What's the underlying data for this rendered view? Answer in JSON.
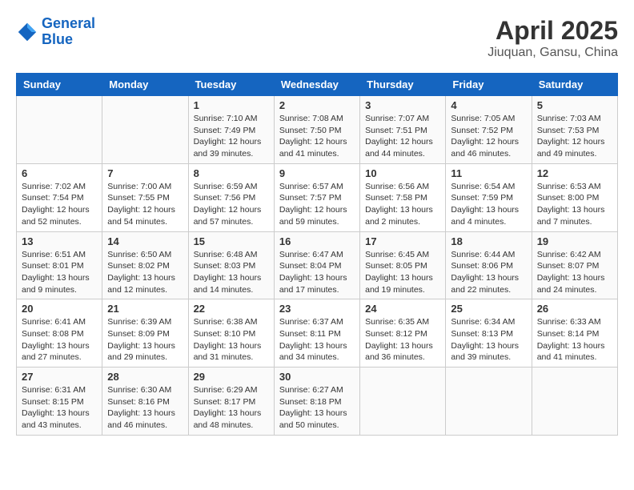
{
  "logo": {
    "line1": "General",
    "line2": "Blue"
  },
  "title": "April 2025",
  "subtitle": "Jiuquan, Gansu, China",
  "weekdays": [
    "Sunday",
    "Monday",
    "Tuesday",
    "Wednesday",
    "Thursday",
    "Friday",
    "Saturday"
  ],
  "weeks": [
    [
      {
        "day": "",
        "info": ""
      },
      {
        "day": "",
        "info": ""
      },
      {
        "day": "1",
        "info": "Sunrise: 7:10 AM\nSunset: 7:49 PM\nDaylight: 12 hours\nand 39 minutes."
      },
      {
        "day": "2",
        "info": "Sunrise: 7:08 AM\nSunset: 7:50 PM\nDaylight: 12 hours\nand 41 minutes."
      },
      {
        "day": "3",
        "info": "Sunrise: 7:07 AM\nSunset: 7:51 PM\nDaylight: 12 hours\nand 44 minutes."
      },
      {
        "day": "4",
        "info": "Sunrise: 7:05 AM\nSunset: 7:52 PM\nDaylight: 12 hours\nand 46 minutes."
      },
      {
        "day": "5",
        "info": "Sunrise: 7:03 AM\nSunset: 7:53 PM\nDaylight: 12 hours\nand 49 minutes."
      }
    ],
    [
      {
        "day": "6",
        "info": "Sunrise: 7:02 AM\nSunset: 7:54 PM\nDaylight: 12 hours\nand 52 minutes."
      },
      {
        "day": "7",
        "info": "Sunrise: 7:00 AM\nSunset: 7:55 PM\nDaylight: 12 hours\nand 54 minutes."
      },
      {
        "day": "8",
        "info": "Sunrise: 6:59 AM\nSunset: 7:56 PM\nDaylight: 12 hours\nand 57 minutes."
      },
      {
        "day": "9",
        "info": "Sunrise: 6:57 AM\nSunset: 7:57 PM\nDaylight: 12 hours\nand 59 minutes."
      },
      {
        "day": "10",
        "info": "Sunrise: 6:56 AM\nSunset: 7:58 PM\nDaylight: 13 hours\nand 2 minutes."
      },
      {
        "day": "11",
        "info": "Sunrise: 6:54 AM\nSunset: 7:59 PM\nDaylight: 13 hours\nand 4 minutes."
      },
      {
        "day": "12",
        "info": "Sunrise: 6:53 AM\nSunset: 8:00 PM\nDaylight: 13 hours\nand 7 minutes."
      }
    ],
    [
      {
        "day": "13",
        "info": "Sunrise: 6:51 AM\nSunset: 8:01 PM\nDaylight: 13 hours\nand 9 minutes."
      },
      {
        "day": "14",
        "info": "Sunrise: 6:50 AM\nSunset: 8:02 PM\nDaylight: 13 hours\nand 12 minutes."
      },
      {
        "day": "15",
        "info": "Sunrise: 6:48 AM\nSunset: 8:03 PM\nDaylight: 13 hours\nand 14 minutes."
      },
      {
        "day": "16",
        "info": "Sunrise: 6:47 AM\nSunset: 8:04 PM\nDaylight: 13 hours\nand 17 minutes."
      },
      {
        "day": "17",
        "info": "Sunrise: 6:45 AM\nSunset: 8:05 PM\nDaylight: 13 hours\nand 19 minutes."
      },
      {
        "day": "18",
        "info": "Sunrise: 6:44 AM\nSunset: 8:06 PM\nDaylight: 13 hours\nand 22 minutes."
      },
      {
        "day": "19",
        "info": "Sunrise: 6:42 AM\nSunset: 8:07 PM\nDaylight: 13 hours\nand 24 minutes."
      }
    ],
    [
      {
        "day": "20",
        "info": "Sunrise: 6:41 AM\nSunset: 8:08 PM\nDaylight: 13 hours\nand 27 minutes."
      },
      {
        "day": "21",
        "info": "Sunrise: 6:39 AM\nSunset: 8:09 PM\nDaylight: 13 hours\nand 29 minutes."
      },
      {
        "day": "22",
        "info": "Sunrise: 6:38 AM\nSunset: 8:10 PM\nDaylight: 13 hours\nand 31 minutes."
      },
      {
        "day": "23",
        "info": "Sunrise: 6:37 AM\nSunset: 8:11 PM\nDaylight: 13 hours\nand 34 minutes."
      },
      {
        "day": "24",
        "info": "Sunrise: 6:35 AM\nSunset: 8:12 PM\nDaylight: 13 hours\nand 36 minutes."
      },
      {
        "day": "25",
        "info": "Sunrise: 6:34 AM\nSunset: 8:13 PM\nDaylight: 13 hours\nand 39 minutes."
      },
      {
        "day": "26",
        "info": "Sunrise: 6:33 AM\nSunset: 8:14 PM\nDaylight: 13 hours\nand 41 minutes."
      }
    ],
    [
      {
        "day": "27",
        "info": "Sunrise: 6:31 AM\nSunset: 8:15 PM\nDaylight: 13 hours\nand 43 minutes."
      },
      {
        "day": "28",
        "info": "Sunrise: 6:30 AM\nSunset: 8:16 PM\nDaylight: 13 hours\nand 46 minutes."
      },
      {
        "day": "29",
        "info": "Sunrise: 6:29 AM\nSunset: 8:17 PM\nDaylight: 13 hours\nand 48 minutes."
      },
      {
        "day": "30",
        "info": "Sunrise: 6:27 AM\nSunset: 8:18 PM\nDaylight: 13 hours\nand 50 minutes."
      },
      {
        "day": "",
        "info": ""
      },
      {
        "day": "",
        "info": ""
      },
      {
        "day": "",
        "info": ""
      }
    ]
  ]
}
